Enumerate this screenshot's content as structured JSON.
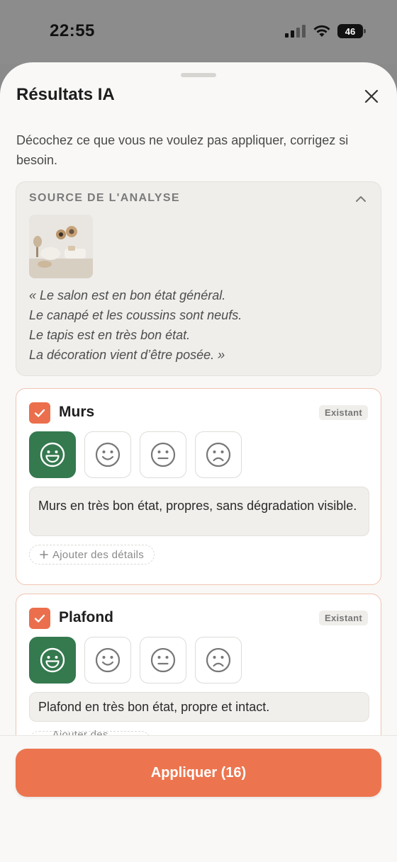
{
  "status_bar": {
    "time": "22:55",
    "battery": "46"
  },
  "sheet": {
    "title": "Résultats IA",
    "subtitle": "Décochez ce que vous ne voulez pas appliquer, corrigez si besoin."
  },
  "source": {
    "header": "SOURCE DE L'ANALYSE",
    "quote_lines": [
      "« Le salon est en bon état général.",
      "Le canapé et les coussins sont neufs.",
      "Le tapis est en très bon état.",
      "La décoration vient d’être posée. »"
    ]
  },
  "items": [
    {
      "title": "Murs",
      "badge": "Existant",
      "checked": true,
      "rating": "very-good",
      "comment": "Murs en très bon état, propres, sans dégradation visible.",
      "add_details": "Ajouter des détails"
    },
    {
      "title": "Plafond",
      "badge": "Existant",
      "checked": true,
      "rating": "very-good",
      "comment": "Plafond en très bon état, propre et intact.",
      "add_details": "Ajouter des détails"
    }
  ],
  "footer": {
    "apply_label": "Appliquer (16)"
  },
  "colors": {
    "accent": "#ec7550",
    "selected_face": "#35794f",
    "card_border": "#f1c3b1"
  }
}
